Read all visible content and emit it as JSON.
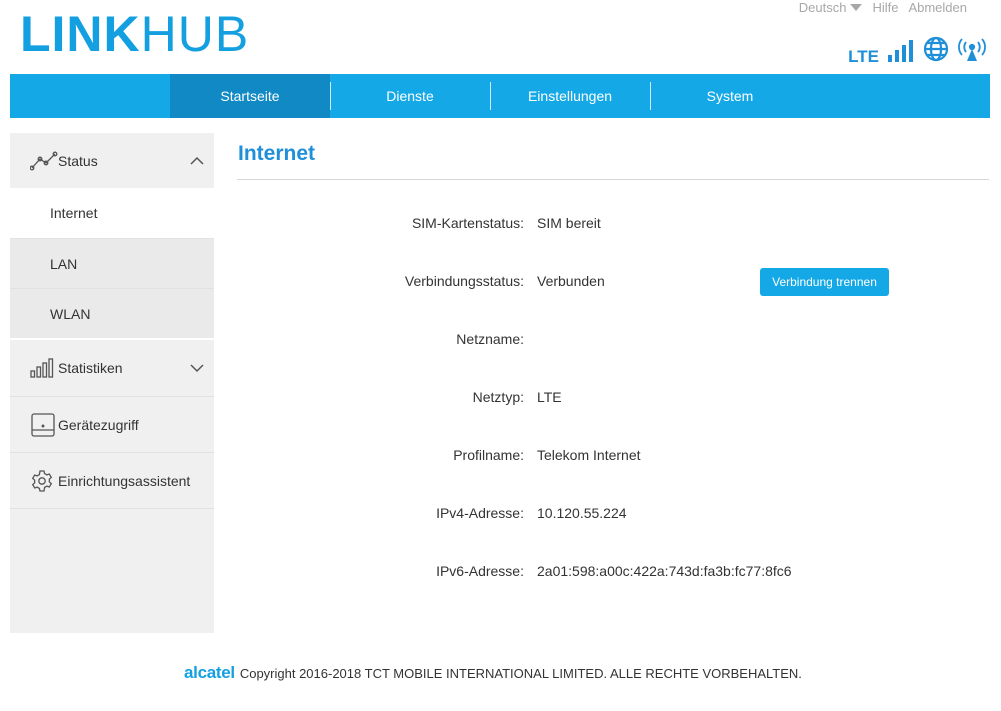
{
  "header": {
    "logo_bold": "LINK",
    "logo_light": "HUB",
    "top_links": {
      "language": "Deutsch",
      "help": "Hilfe",
      "logout": "Abmelden"
    },
    "status": {
      "network_type": "LTE",
      "icons": [
        "signal-bars-icon",
        "globe-icon",
        "wifi-broadcast-icon"
      ]
    }
  },
  "nav": {
    "items": [
      {
        "label": "Startseite",
        "active": true
      },
      {
        "label": "Dienste",
        "active": false
      },
      {
        "label": "Einstellungen",
        "active": false
      },
      {
        "label": "System",
        "active": false
      }
    ]
  },
  "sidebar": {
    "status_label": "Status",
    "sub_internet": "Internet",
    "sub_lan": "LAN",
    "sub_wlan": "WLAN",
    "statistics_label": "Statistiken",
    "device_access_label": "Gerätezugriff",
    "setup_wizard_label": "Einrichtungsassistent"
  },
  "main": {
    "title": "Internet",
    "rows": [
      {
        "label": "SIM-Kartenstatus:",
        "value": "SIM bereit"
      },
      {
        "label": "Verbindungsstatus:",
        "value": "Verbunden"
      },
      {
        "label": "Netzname:",
        "value": ""
      },
      {
        "label": "Netztyp:",
        "value": "LTE"
      },
      {
        "label": "Profilname:",
        "value": "Telekom Internet"
      },
      {
        "label": "IPv4-Adresse:",
        "value": "10.120.55.224"
      },
      {
        "label": "IPv6-Adresse:",
        "value": "2a01:598:a00c:422a:743d:fa3b:fc77:8fc6"
      }
    ],
    "disconnect_button": "Verbindung trennen"
  },
  "footer": {
    "brand": "alcatel",
    "copyright": "Copyright 2016-2018 TCT MOBILE INTERNATIONAL LIMITED. ALLE RECHTE VORBEHALTEN."
  },
  "colors": {
    "accent": "#14a9e6",
    "accent_dark": "#1089c4",
    "title_blue": "#1e8fd8",
    "sidebar_bg": "#f0f0f0"
  }
}
